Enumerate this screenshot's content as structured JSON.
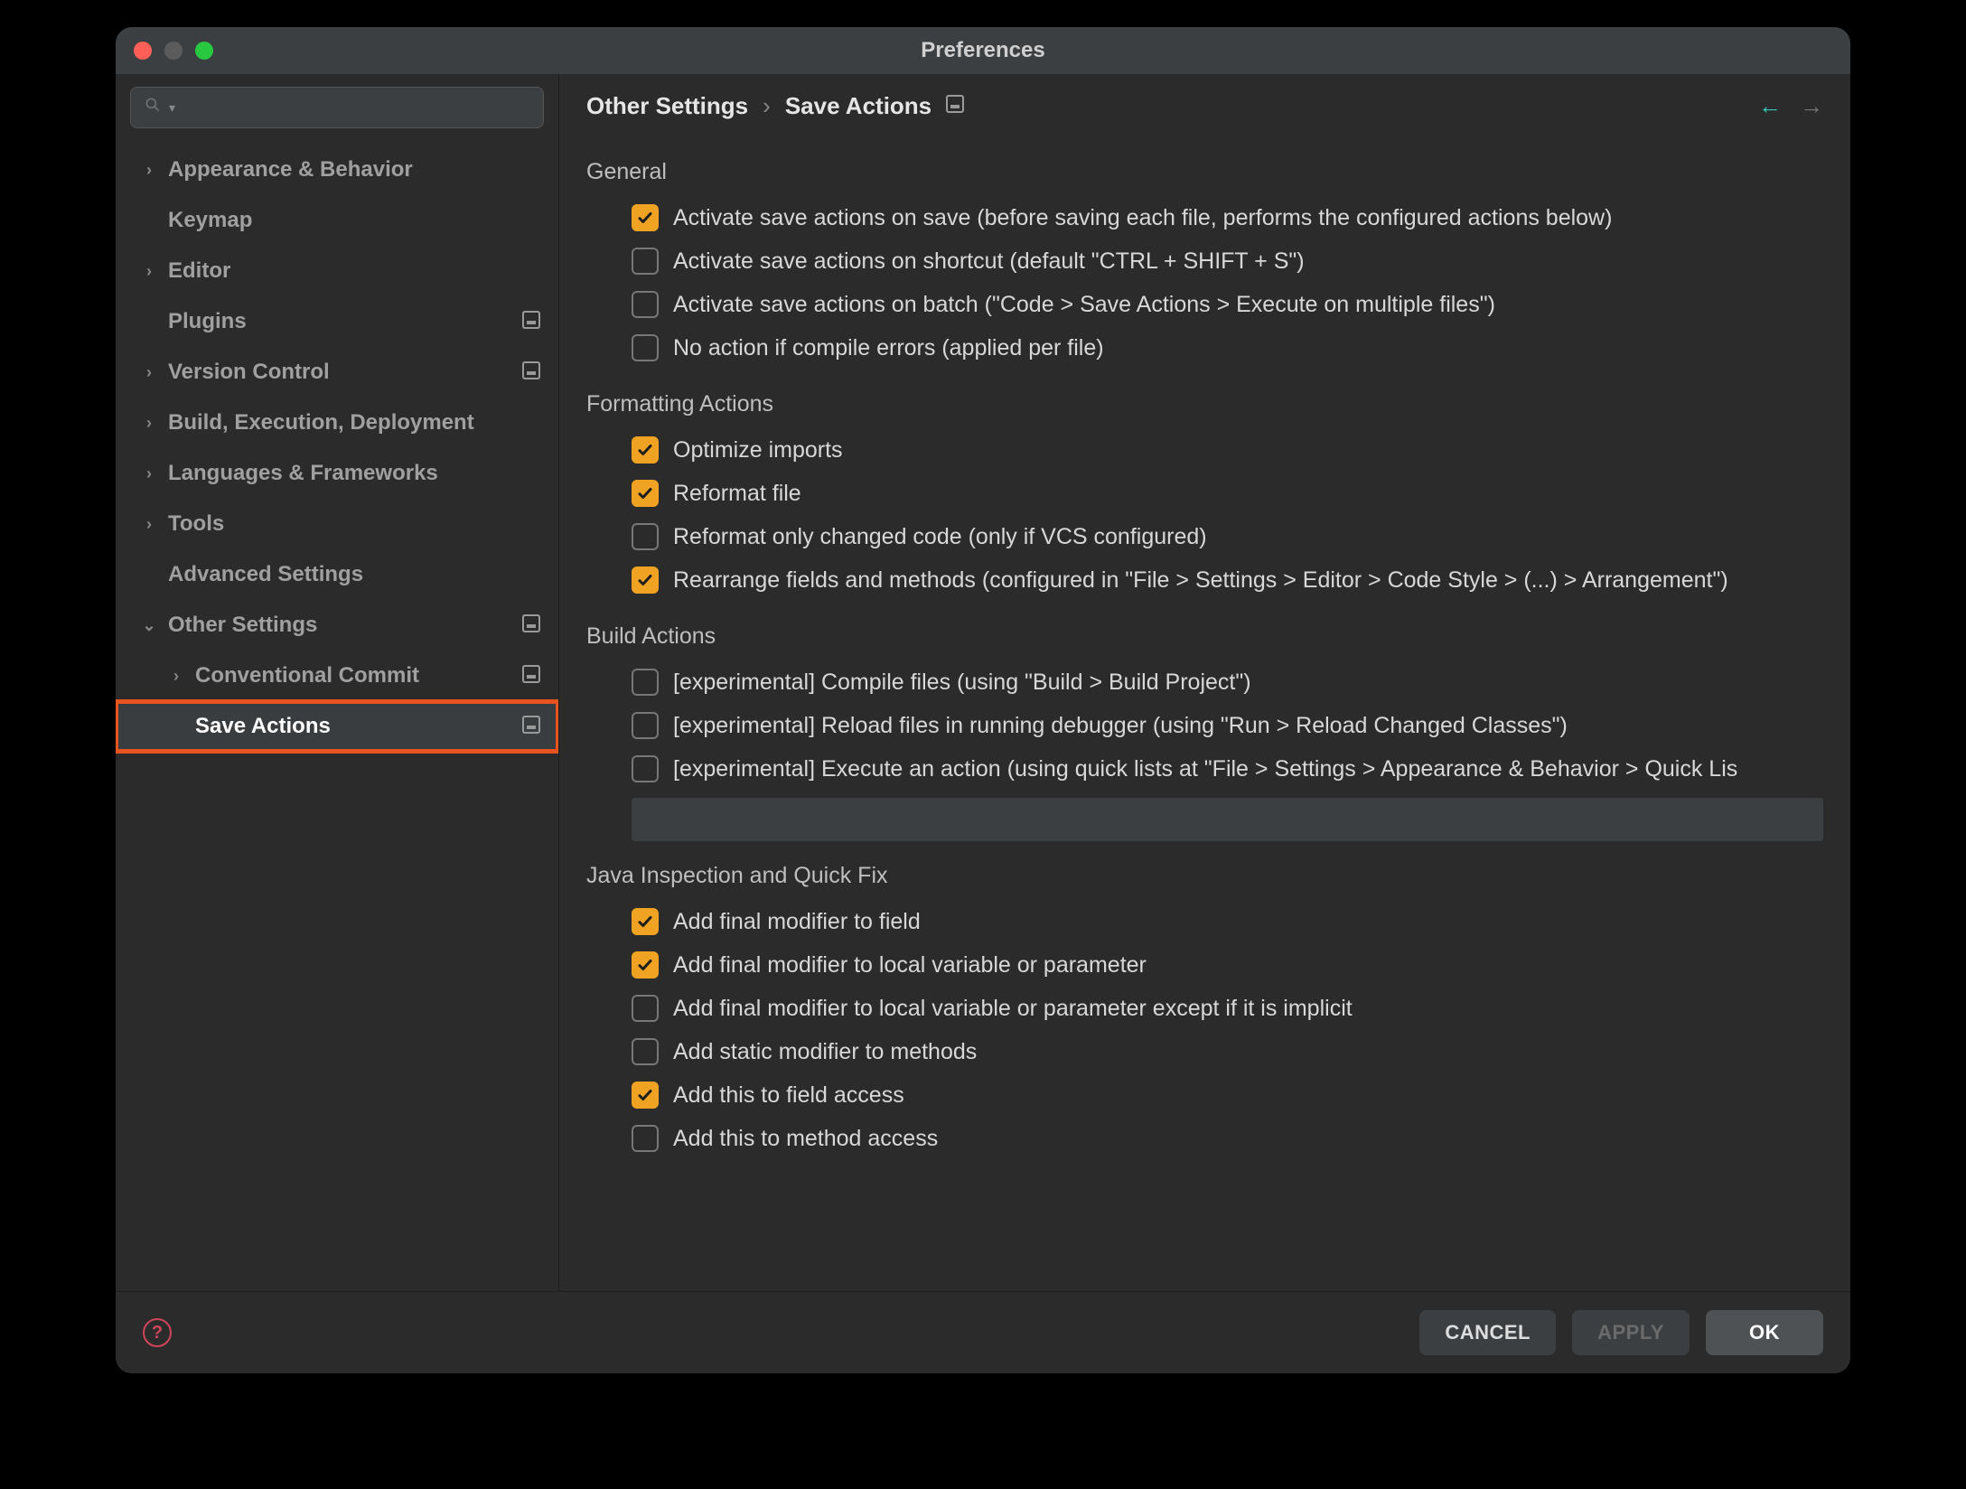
{
  "window": {
    "title": "Preferences"
  },
  "search": {
    "placeholder": ""
  },
  "sidebar": {
    "items": [
      {
        "label": "Appearance & Behavior",
        "expandable": true,
        "expanded": false,
        "disk": false,
        "indent": 0
      },
      {
        "label": "Keymap",
        "expandable": false,
        "expanded": false,
        "disk": false,
        "indent": 0
      },
      {
        "label": "Editor",
        "expandable": true,
        "expanded": false,
        "disk": false,
        "indent": 0
      },
      {
        "label": "Plugins",
        "expandable": false,
        "expanded": false,
        "disk": true,
        "indent": 0
      },
      {
        "label": "Version Control",
        "expandable": true,
        "expanded": false,
        "disk": true,
        "indent": 0
      },
      {
        "label": "Build, Execution, Deployment",
        "expandable": true,
        "expanded": false,
        "disk": false,
        "indent": 0
      },
      {
        "label": "Languages & Frameworks",
        "expandable": true,
        "expanded": false,
        "disk": false,
        "indent": 0
      },
      {
        "label": "Tools",
        "expandable": true,
        "expanded": false,
        "disk": false,
        "indent": 0
      },
      {
        "label": "Advanced Settings",
        "expandable": false,
        "expanded": false,
        "disk": false,
        "indent": 0
      },
      {
        "label": "Other Settings",
        "expandable": true,
        "expanded": true,
        "disk": true,
        "indent": 0
      },
      {
        "label": "Conventional Commit",
        "expandable": true,
        "expanded": false,
        "disk": true,
        "indent": 1
      },
      {
        "label": "Save Actions",
        "expandable": false,
        "expanded": false,
        "disk": true,
        "indent": 1,
        "selected": true,
        "highlighted": true
      }
    ]
  },
  "breadcrumb": {
    "root": "Other Settings",
    "sep": "›",
    "leaf": "Save Actions"
  },
  "sections": [
    {
      "title": "General",
      "options": [
        {
          "checked": true,
          "label": "Activate save actions on save (before saving each file, performs the configured actions below)"
        },
        {
          "checked": false,
          "label": "Activate save actions on shortcut (default \"CTRL + SHIFT + S\")"
        },
        {
          "checked": false,
          "label": "Activate save actions on batch (\"Code > Save Actions > Execute on multiple files\")"
        },
        {
          "checked": false,
          "label": "No action if compile errors (applied per file)"
        }
      ]
    },
    {
      "title": "Formatting Actions",
      "options": [
        {
          "checked": true,
          "label": "Optimize imports"
        },
        {
          "checked": true,
          "label": "Reformat file"
        },
        {
          "checked": false,
          "label": "Reformat only changed code (only if VCS configured)"
        },
        {
          "checked": true,
          "label": "Rearrange fields and methods (configured in \"File > Settings > Editor > Code Style > (...) > Arrangement\")"
        }
      ]
    },
    {
      "title": "Build Actions",
      "options": [
        {
          "checked": false,
          "label": "[experimental] Compile files (using \"Build > Build Project\")"
        },
        {
          "checked": false,
          "label": "[experimental] Reload files in running debugger (using \"Run > Reload Changed Classes\")"
        },
        {
          "checked": false,
          "label": "[experimental] Execute an action (using quick lists at \"File > Settings > Appearance & Behavior > Quick Lis"
        }
      ],
      "hasField": true
    },
    {
      "title": "Java Inspection and Quick Fix",
      "options": [
        {
          "checked": true,
          "label": "Add final modifier to field"
        },
        {
          "checked": true,
          "label": "Add final modifier to local variable or parameter"
        },
        {
          "checked": false,
          "label": "Add final modifier to local variable or parameter except if it is implicit"
        },
        {
          "checked": false,
          "label": "Add static modifier to methods"
        },
        {
          "checked": true,
          "label": "Add this to field access"
        },
        {
          "checked": false,
          "label": "Add this to method access"
        }
      ]
    }
  ],
  "footer": {
    "cancel": "CANCEL",
    "apply": "APPLY",
    "ok": "OK"
  }
}
